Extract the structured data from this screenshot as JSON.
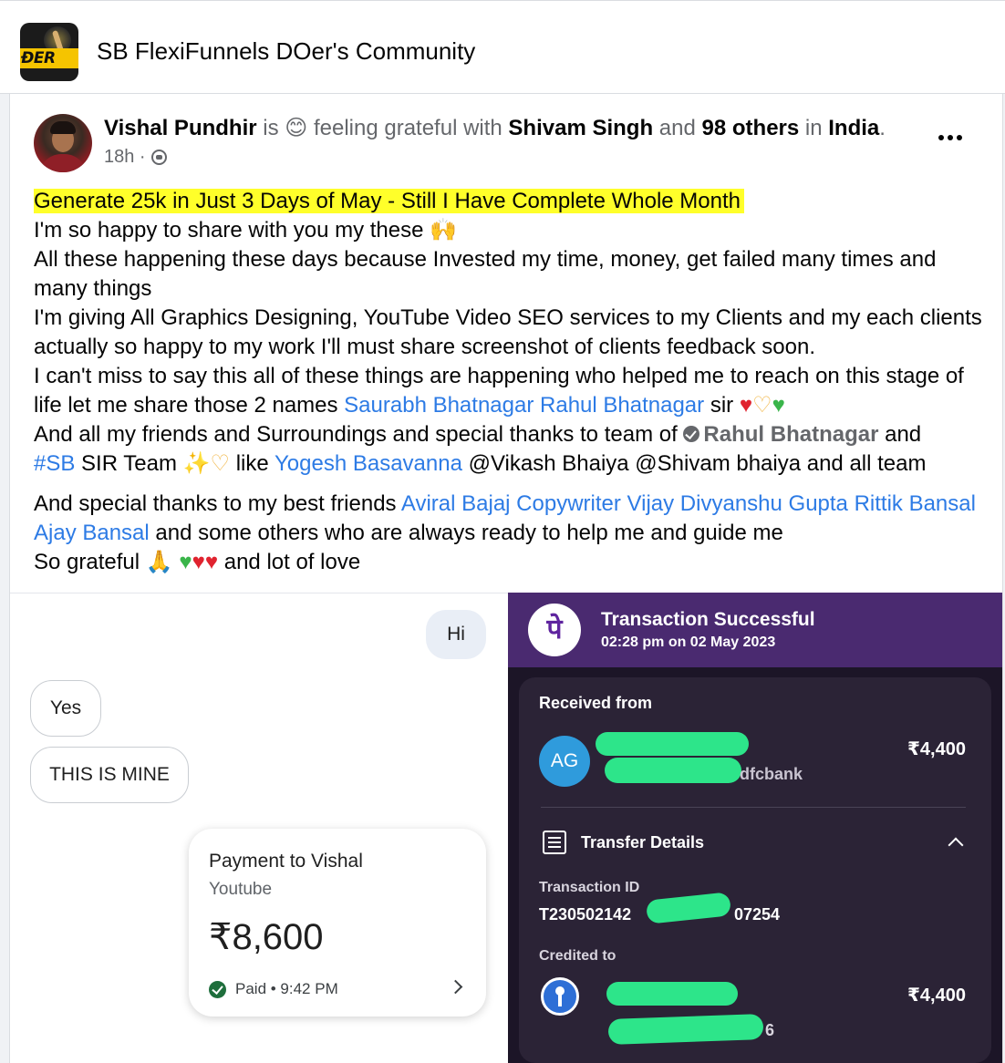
{
  "group": {
    "logo_text": "ÐER",
    "title": "SB FlexiFunnels DOer's Community"
  },
  "post": {
    "author": "Vishal Pundhir",
    "is_word": " is ",
    "feeling_emoji": "😊",
    "feeling_text": " feeling grateful with ",
    "tagged_person": "Shivam Singh",
    "and_word": " and ",
    "others": "98 others",
    "in_word": " in ",
    "location": "India",
    "period": ".",
    "time": "18h ·",
    "headline": "Generate 25k in Just 3 Days of May - Still I  Have Complete Whole Month",
    "line1": "I'm so happy to share with you my these 🙌",
    "line2": "All these happening these days because Invested my time, money, get failed many times and many things",
    "line3": "I'm giving All Graphics Designing, YouTube Video SEO services  to my Clients and my each clients actually so happy to my work I'll must share screenshot of clients feedback soon.",
    "line4_a": "I can't miss to say this all of these things are happening who helped me to reach on this stage of life  let me share those 2 names ",
    "line4_link1": "Saurabh Bhatnagar",
    "line4_link2": "Rahul Bhatnagar",
    "line4_b": "  sir ",
    "line5_a": "And all my friends and Surroundings and special thanks to team of ",
    "line5_mention": "Rahul Bhatnagar",
    "line5_b": " and",
    "line6_hashtag": "#SB",
    "line6_a": " SIR Team ",
    "line6_b": " like ",
    "line6_link": "Yogesh Basavanna",
    "line6_c": "  @Vikash Bhaiya @Shivam bhaiya and all team",
    "line7_a": "And special thanks to my best friends ",
    "line7_link1": "Aviral Bajaj Copywriter",
    "line7_link2": "Vijay Divyanshu Gupta",
    "line7_link3": "Rittik Bansal",
    "line7_link4": "Ajay Bansal",
    "line7_b": " and some others who are always ready to help me and guide me",
    "line8_a": "So grateful ",
    "line8_b": " and lot of love"
  },
  "chat": {
    "hi": "Hi",
    "yes": "Yes",
    "mine": "THIS IS MINE",
    "payment_title": "Payment to Vishal",
    "payment_sub": "Youtube",
    "payment_amount": "₹8,600",
    "payment_status": "Paid • 9:42 PM"
  },
  "phonepe": {
    "logo": "पे",
    "title": "Transaction Successful",
    "time": "02:28 pm on 02 May 2023",
    "received_from": "Received from",
    "sender_initials": "AG",
    "sender_bank_tail": "dfcbank",
    "amount_received": "₹4,400",
    "transfer_details": "Transfer Details",
    "transaction_id_label": "Transaction ID",
    "transaction_id_head": "T230502142",
    "transaction_id_tail": "07254",
    "credited_to": "Credited to",
    "account_tail": "6",
    "amount_credited": "₹4,400"
  },
  "colors": {
    "highlight": "#ffff2a",
    "link": "#2d7be5",
    "phonepe_purple": "#4a2a70",
    "redaction": "#2de58a"
  }
}
